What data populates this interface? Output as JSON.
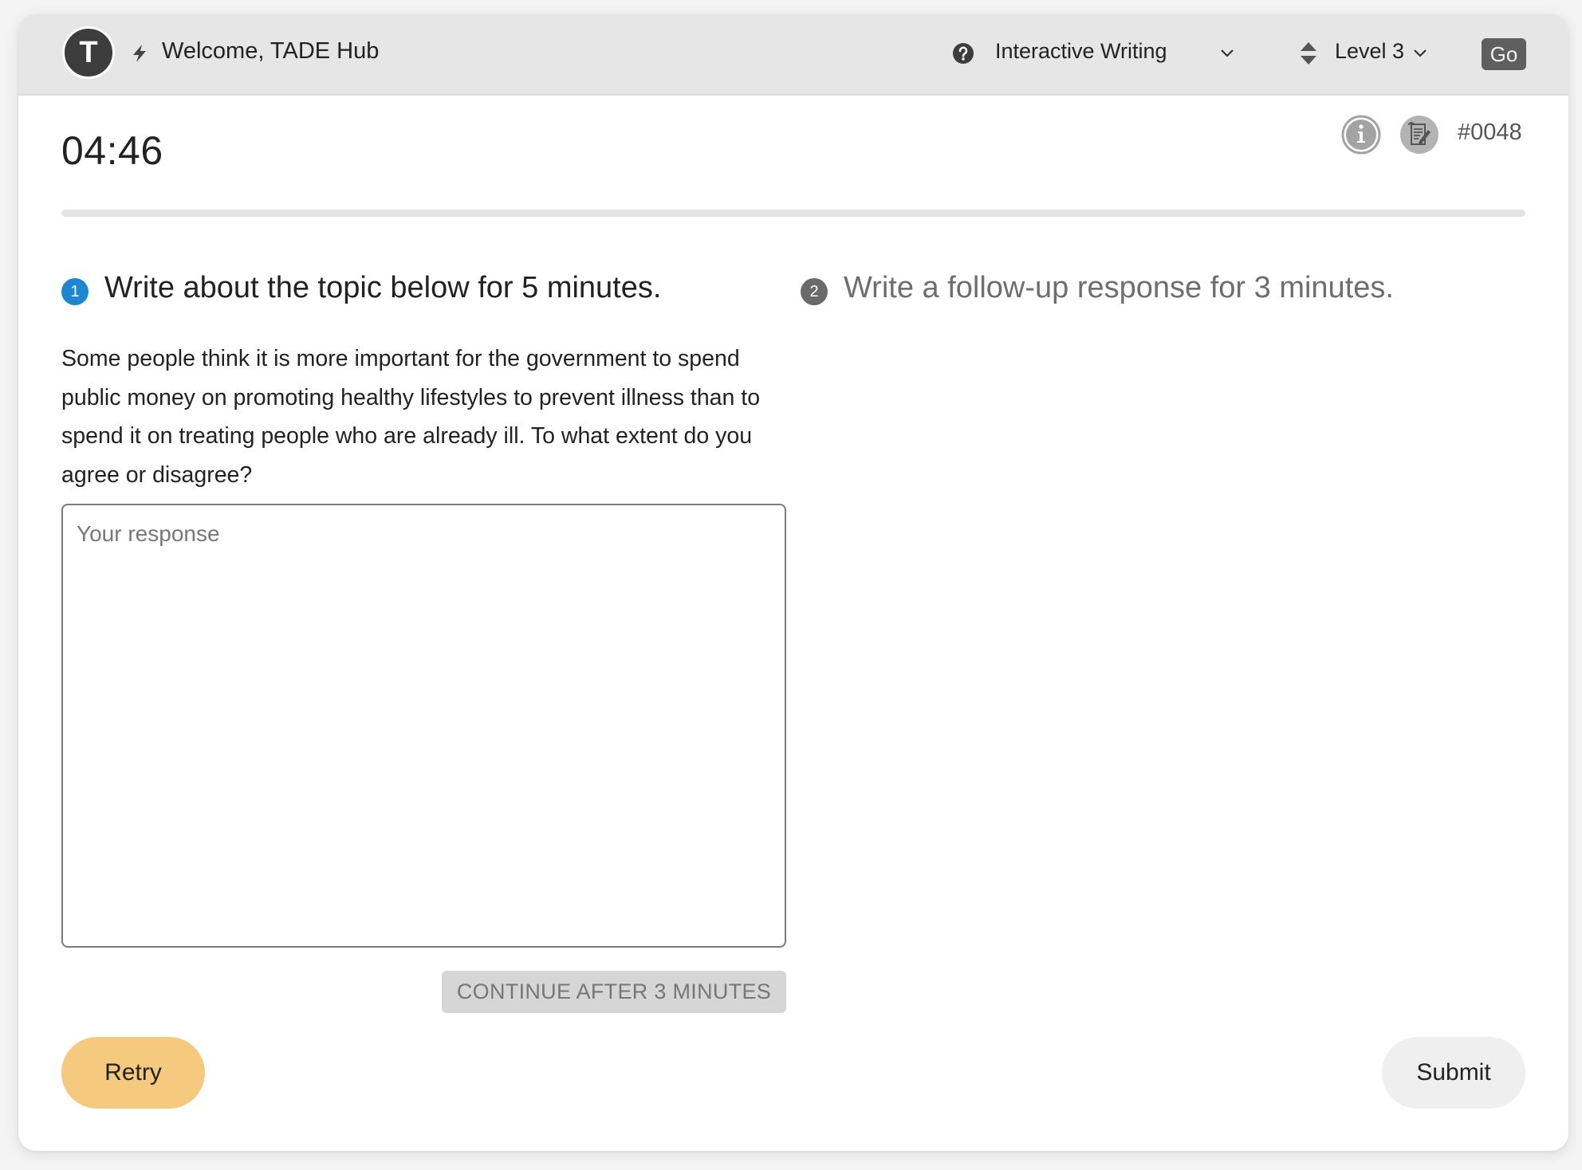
{
  "header": {
    "avatar_initial": "T",
    "welcome_text": "Welcome, TADE Hub",
    "mode_select": {
      "selected": "Interactive Writing"
    },
    "level_select": {
      "selected": "Level 3"
    },
    "go_label": "Go"
  },
  "status": {
    "timer": "04:46",
    "question_id": "#0048",
    "progress_fraction": 0
  },
  "steps": [
    {
      "number": "1",
      "title": "Write about the topic below for 5 minutes.",
      "active": true,
      "color": "#1f87cf"
    },
    {
      "number": "2",
      "title": "Write a follow-up response for 3 minutes.",
      "active": false,
      "color": "#6a6a6a"
    }
  ],
  "prompt": {
    "text": "Some people think it is more important for the government to spend public money on promoting healthy lifestyles to prevent illness than to spend it on treating people who are already ill. To what extent do you agree or disagree?"
  },
  "response": {
    "value": "",
    "placeholder": "Your response"
  },
  "buttons": {
    "continue_label": "CONTINUE AFTER 3 MINUTES",
    "retry_label": "Retry",
    "submit_label": "Submit"
  },
  "colors": {
    "accent": "#1f87cf",
    "retry": "#f5c97e",
    "header_bg": "#e6e6e6"
  }
}
